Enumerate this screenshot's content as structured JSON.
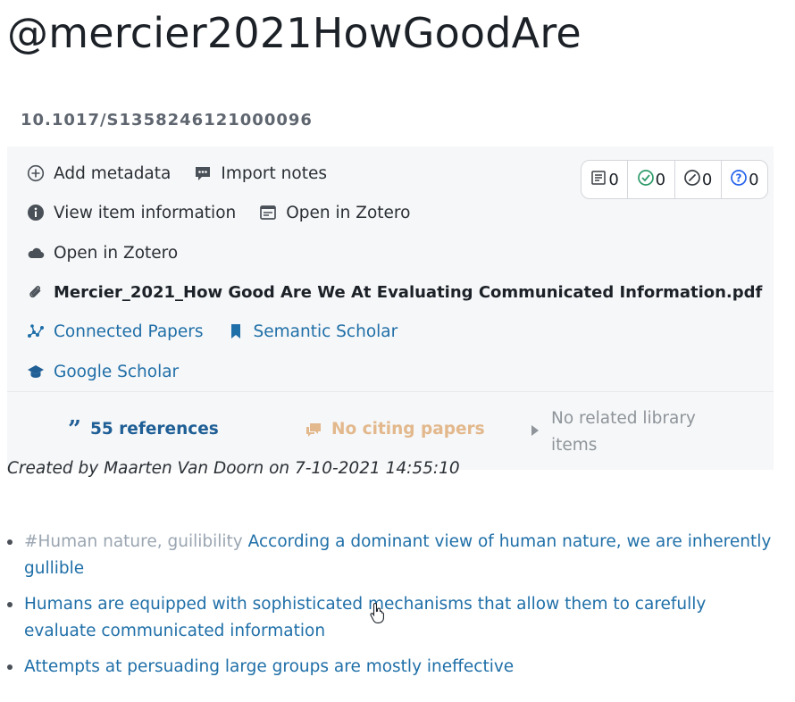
{
  "page": {
    "title": "@mercier2021HowGoodAre",
    "doi": "10.1017/S1358246121000096"
  },
  "actions": {
    "add_metadata": "Add metadata",
    "import_notes": "Import notes",
    "view_item_information": "View item information",
    "open_in_zotero": "Open in Zotero",
    "open_in_zotero_cloud": "Open in Zotero",
    "pdf_filename": "Mercier_2021_How Good Are We At Evaluating Communicated Information.pdf",
    "connected_papers": "Connected Papers",
    "semantic_scholar": "Semantic Scholar",
    "google_scholar": "Google Scholar"
  },
  "counts": {
    "notes": "0",
    "checked": "0",
    "gauge": "0",
    "questions": "0"
  },
  "references": {
    "references_label": "55 references",
    "citing_label": "No citing papers",
    "related_label": "No related library items"
  },
  "created": "Created by Maarten Van Doorn on 7-10-2021 14:55:10",
  "bullets": [
    {
      "tag": "#Human nature, guilibility",
      "text": "According a dominant view of human nature, we are inherently gullible"
    },
    {
      "tag": "",
      "text": "Humans are equipped with sophisticated mechanisms that allow them to carefully evaluate communicated information"
    },
    {
      "tag": "",
      "text": "Attempts at persuading large groups are mostly ineffective"
    }
  ],
  "colors": {
    "link": "#1f6fa8",
    "references": "#1f5f96",
    "citing_disabled": "#e2b88c",
    "panel_bg": "#f6f7f8",
    "check_green": "#2e9b6a",
    "question_blue": "#2563eb"
  }
}
